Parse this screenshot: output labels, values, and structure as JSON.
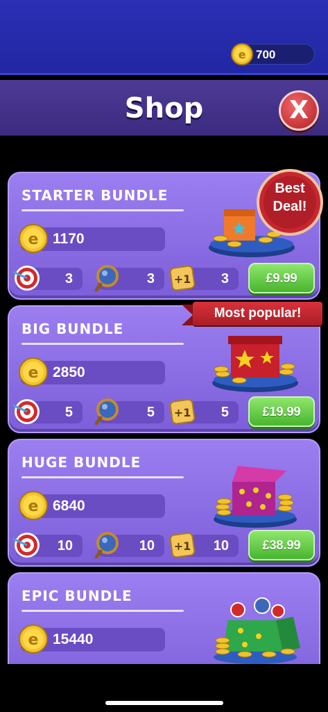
{
  "currency": {
    "balance": "700"
  },
  "header": {
    "title": "Shop",
    "close_label": "X"
  },
  "badges": {
    "best_deal_line1": "Best",
    "best_deal_line2": "Deal!",
    "most_popular": "Most popular!"
  },
  "bundles": [
    {
      "name": "STARTER BUNDLE",
      "coins": "1170",
      "target": "3",
      "magnifier": "3",
      "plus_one": "3",
      "price": "£9.99"
    },
    {
      "name": "BIG BUNDLE",
      "coins": "2850",
      "target": "5",
      "magnifier": "5",
      "plus_one": "5",
      "price": "£19.99"
    },
    {
      "name": "HUGE BUNDLE",
      "coins": "6840",
      "target": "10",
      "magnifier": "10",
      "plus_one": "10",
      "price": "£38.99"
    },
    {
      "name": "EPIC BUNDLE",
      "coins": "15440",
      "target": "",
      "magnifier": "",
      "plus_one": "",
      "price": ""
    }
  ],
  "icons": {
    "coin": "e-coin-icon",
    "target": "target-icon",
    "magnifier": "magnifier-icon",
    "plus_one": "plus-one-tile-icon",
    "close": "close-icon"
  },
  "colors": {
    "price_button": "#5cc63e",
    "card": "#8b6fe6",
    "badge_red": "#c0262f",
    "topbar": "#2a2fb5"
  }
}
